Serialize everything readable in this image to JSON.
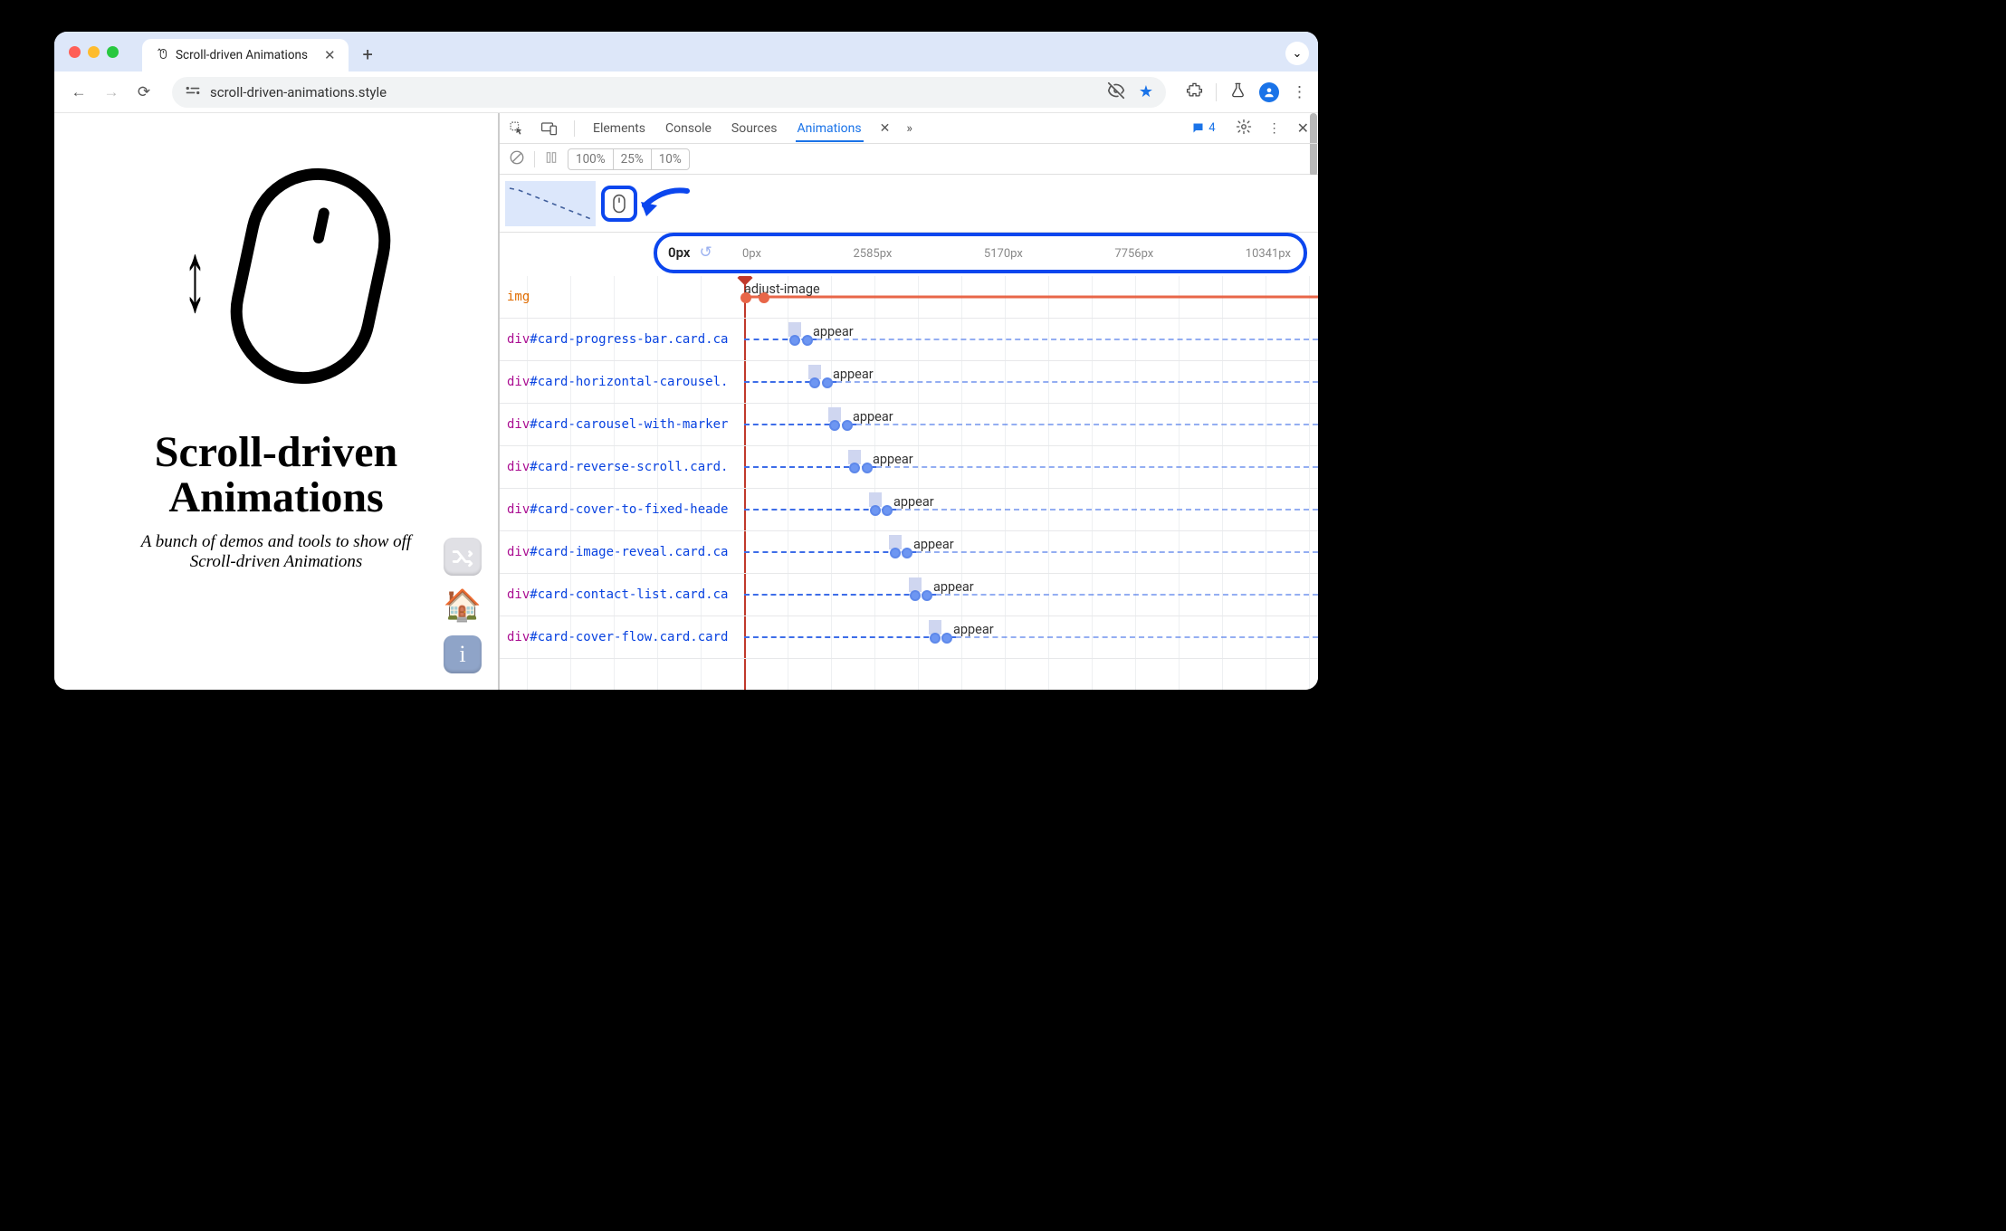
{
  "browser": {
    "tab_title": "Scroll-driven Animations",
    "url": "scroll-driven-animations.style"
  },
  "page": {
    "title_line1": "Scroll-driven",
    "title_line2": "Animations",
    "subtitle_line1": "A bunch of demos and tools to show off",
    "subtitle_line2": "Scroll-driven Animations"
  },
  "devtools": {
    "tabs": [
      "Elements",
      "Console",
      "Sources",
      "Animations"
    ],
    "active_tab": "Animations",
    "message_count": "4",
    "speeds": [
      "100%",
      "25%",
      "10%"
    ],
    "ruler": {
      "current": "0px",
      "ticks": [
        "0px",
        "2585px",
        "5170px",
        "7756px",
        "10341px"
      ]
    },
    "rows": [
      {
        "tag": "img",
        "id": "",
        "cls": "",
        "anim": "adjust-image",
        "kind": "img",
        "start": 0,
        "kf1": 2,
        "kf2": 22
      },
      {
        "tag": "div",
        "id": "#card-progress-bar",
        "cls": ".card.ca",
        "anim": "appear",
        "kind": "blue",
        "start": 50,
        "kf1": 56,
        "kf2": 70
      },
      {
        "tag": "div",
        "id": "#card-horizontal-carousel",
        "cls": ".",
        "anim": "appear",
        "kind": "blue",
        "start": 72,
        "kf1": 78,
        "kf2": 92
      },
      {
        "tag": "div",
        "id": "#card-carousel-with-marker",
        "cls": "",
        "anim": "appear",
        "kind": "blue",
        "start": 94,
        "kf1": 100,
        "kf2": 114
      },
      {
        "tag": "div",
        "id": "#card-reverse-scroll",
        "cls": ".card.",
        "anim": "appear",
        "kind": "blue",
        "start": 116,
        "kf1": 122,
        "kf2": 136
      },
      {
        "tag": "div",
        "id": "#card-cover-to-fixed-heade",
        "cls": "",
        "anim": "appear",
        "kind": "blue",
        "start": 138,
        "kf1": 145,
        "kf2": 158
      },
      {
        "tag": "div",
        "id": "#card-image-reveal",
        "cls": ".card.ca",
        "anim": "appear",
        "kind": "blue",
        "start": 160,
        "kf1": 167,
        "kf2": 180
      },
      {
        "tag": "div",
        "id": "#card-contact-list",
        "cls": ".card.ca",
        "anim": "appear",
        "kind": "blue",
        "start": 182,
        "kf1": 189,
        "kf2": 202
      },
      {
        "tag": "div",
        "id": "#card-cover-flow",
        "cls": ".card.card",
        "anim": "appear",
        "kind": "blue",
        "start": 204,
        "kf1": 211,
        "kf2": 224
      }
    ]
  }
}
